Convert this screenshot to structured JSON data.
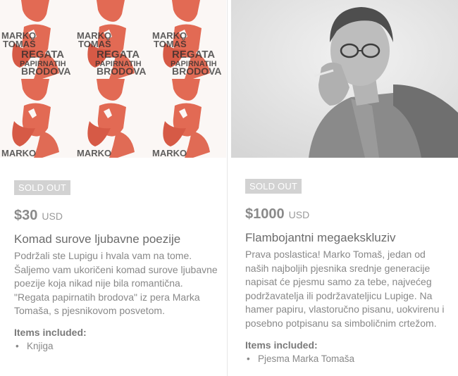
{
  "rewards": [
    {
      "image_alt": "Regata papirnatih brodova book cover",
      "cover_text": {
        "line1": "MARKO",
        "line2": "TOMAŠ",
        "line3": "REGATA",
        "line4": "PAPIRNATIH",
        "line5": "BRODOVA"
      },
      "badge": "SOLD OUT",
      "price": "$30",
      "currency": "USD",
      "title": "Komad surove ljubavne poezije",
      "description": "Podržali ste Lupigu i hvala vam na tome. Šaljemo vam ukoričeni komad surove ljubavne poezije koja nikad nije bila romantična. \"Regata papirnatih brodova\" iz pera Marka Tomaša, s pjesnikovom posvetom.",
      "items_heading": "Items included:",
      "items": [
        "Knjiga"
      ]
    },
    {
      "image_alt": "Portrait of Marko Tomaš",
      "badge": "SOLD OUT",
      "price": "$1000",
      "currency": "USD",
      "title": "Flambojantni megaekskluziv",
      "description": "Prava poslastica! Marko Tomaš, jedan od naših najboljih pjesnika srednje generacije napisat će pjesmu samo za tebe, najvećeg podržavatelja ili podržavateljicu Lupige. Na hamer papiru, vlastoručno pisanu, uokvirenu i posebno potpisanu sa simboličnim crtežom.",
      "items_heading": "Items included:",
      "items": [
        "Pjesma Marka Tomaša"
      ]
    }
  ]
}
